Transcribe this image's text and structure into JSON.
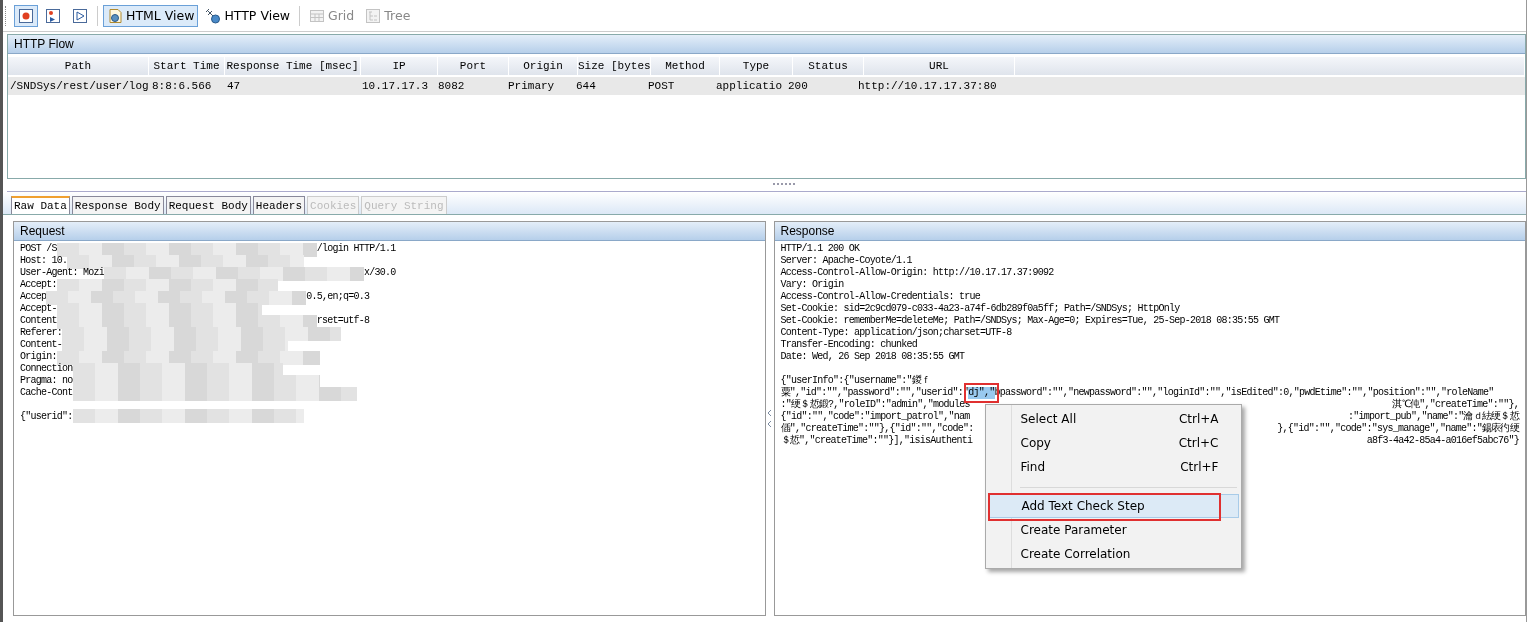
{
  "toolbar": [
    {
      "kind": "record",
      "pressed": true,
      "disabled": false
    },
    {
      "kind": "step",
      "pressed": false,
      "disabled": false
    },
    {
      "kind": "play",
      "pressed": false,
      "disabled": false
    },
    {
      "kind": "separator"
    },
    {
      "kind": "html",
      "label": "HTML View",
      "pressed": true,
      "disabled": false
    },
    {
      "kind": "http",
      "label": "HTTP View",
      "pressed": false,
      "disabled": false
    },
    {
      "kind": "separator"
    },
    {
      "kind": "grid",
      "label": "Grid",
      "pressed": false,
      "disabled": true
    },
    {
      "kind": "tree",
      "label": "Tree",
      "pressed": false,
      "disabled": true
    }
  ],
  "http_flow": {
    "title": "HTTP Flow",
    "columns": [
      "Path",
      "Start Time",
      "Response Time [msec]",
      "IP",
      "Port",
      "Origin",
      "Size [bytes",
      "Method",
      "Type",
      "Status",
      "URL"
    ],
    "rows": [
      {
        "selected": true,
        "cells": [
          "/SNDSys/rest/user/log",
          "8:8:6.566",
          "47",
          "10.17.17.3",
          "8082",
          "Primary",
          "644",
          "POST",
          "applicatio",
          "200",
          "http://10.17.17.37:80"
        ]
      }
    ]
  },
  "tabs": [
    {
      "label": "Raw Data",
      "selected": true,
      "disabled": false
    },
    {
      "label": "Response Body",
      "selected": false,
      "disabled": false
    },
    {
      "label": "Request Body",
      "selected": false,
      "disabled": false
    },
    {
      "label": "Headers",
      "selected": false,
      "disabled": false
    },
    {
      "label": "Cookies",
      "selected": false,
      "disabled": true
    },
    {
      "label": "Query String",
      "selected": false,
      "disabled": true
    }
  ],
  "request": {
    "title": "Request",
    "lines": [
      {
        "text": "POST /S",
        "redacted": true,
        "tail": "/login HTTP/1.1"
      },
      {
        "text": "Host: 10.",
        "redacted": true
      },
      {
        "text": "User-Agent: Mozi",
        "redacted": true,
        "tail": "x/30.0"
      },
      {
        "text": "Accept:",
        "redacted": true
      },
      {
        "text": "Accep",
        "redacted": true,
        "tail": "0.5,en;q=0.3"
      },
      {
        "text": "Accept-",
        "redacted": true
      },
      {
        "text": "Content",
        "redacted": true,
        "tail": "rset=utf-8"
      },
      {
        "text": "Referer:",
        "redacted": true
      },
      {
        "text": "Content-",
        "redacted": true
      },
      {
        "text": "Origin:",
        "redacted": true
      },
      {
        "text": "Connection",
        "redacted": true
      },
      {
        "text": "Pragma: no",
        "redacted": true
      },
      {
        "text": "Cache-Cont",
        "redacted": true
      },
      {
        "text": "{\"userid\":",
        "redacted": true,
        "gap_before": true
      }
    ]
  },
  "response": {
    "title": "Response",
    "lines": [
      {
        "left": "HTTP/1.1 200 OK"
      },
      {
        "left": "Server: Apache-Coyote/1.1"
      },
      {
        "left": "Access-Control-Allow-Origin: http://10.17.17.37:9092"
      },
      {
        "left": "Vary: Origin"
      },
      {
        "left": "Access-Control-Allow-Credentials: true"
      },
      {
        "left": "Set-Cookie: sid=2c9cd079-c033-4a23-a74f-6db289f0a5ff; Path=/SNDSys; HttpOnly"
      },
      {
        "left": "Set-Cookie: rememberMe=deleteMe; Path=/SNDSys; Max-Age=0; Expires=Tue, 25-Sep-2018 08:35:55 GMT"
      },
      {
        "left": "Content-Type: application/json;charset=UTF-8"
      },
      {
        "left": "Transfer-Encoding: chunked"
      },
      {
        "left": "Date: Wed, 26 Sep 2018 08:35:55 GMT"
      },
      {
        "left": "{\"userInfo\":{\"username\":\"鍐ｆ",
        "gap_before": true
      },
      {
        "left": "粟\",\"id\":\"\",\"password\":\"\",\"userid\":\"",
        "selection": "dj\",\"",
        "rest": "bpassword\":\"\",\"newpassword\":\"\",\"loginId\":\"\",\"isEdited\":0,\"pwdEtime\":\"\",\"position\":\"\",\"roleName\""
      },
      {
        "left": ":\"绠＄悊鍛?,\"roleID\":\"admin\",\"modules",
        "right": "淇℃伅\",\"createTime\":\"\"},"
      },
      {
        "left": "{\"id\":\"\",\"code\":\"import_patrol\",\"nam",
        "right": ":\"import_pub\",\"name\":\"瀹ｄ紶绠＄悊"
      },
      {
        "left": "偛\",\"createTime\":\"\"},{\"id\":\"\",\"code\":",
        "right": "},{\"id\":\"\",\"code\":\"sys_manage\",\"name\":\"鍚庡彴绠"
      },
      {
        "left": "＄悊\",\"createTime\":\"\"}],\"isisAuthenti",
        "right": "a8f3-4a42-85a4-a016ef5abc76\"}"
      }
    ]
  },
  "context_menu": {
    "items": [
      {
        "kind": "item",
        "label": "Select All",
        "shortcut": "Ctrl+A",
        "highlighted": false
      },
      {
        "kind": "item",
        "label": "Copy",
        "shortcut": "Ctrl+C",
        "highlighted": false
      },
      {
        "kind": "item",
        "label": "Find",
        "shortcut": "Ctrl+F",
        "highlighted": false
      },
      {
        "kind": "separator"
      },
      {
        "kind": "item",
        "label": "Add Text Check Step",
        "highlighted": true
      },
      {
        "kind": "item",
        "label": "Create Parameter",
        "highlighted": false
      },
      {
        "kind": "item",
        "label": "Create Correlation",
        "highlighted": false
      }
    ]
  }
}
